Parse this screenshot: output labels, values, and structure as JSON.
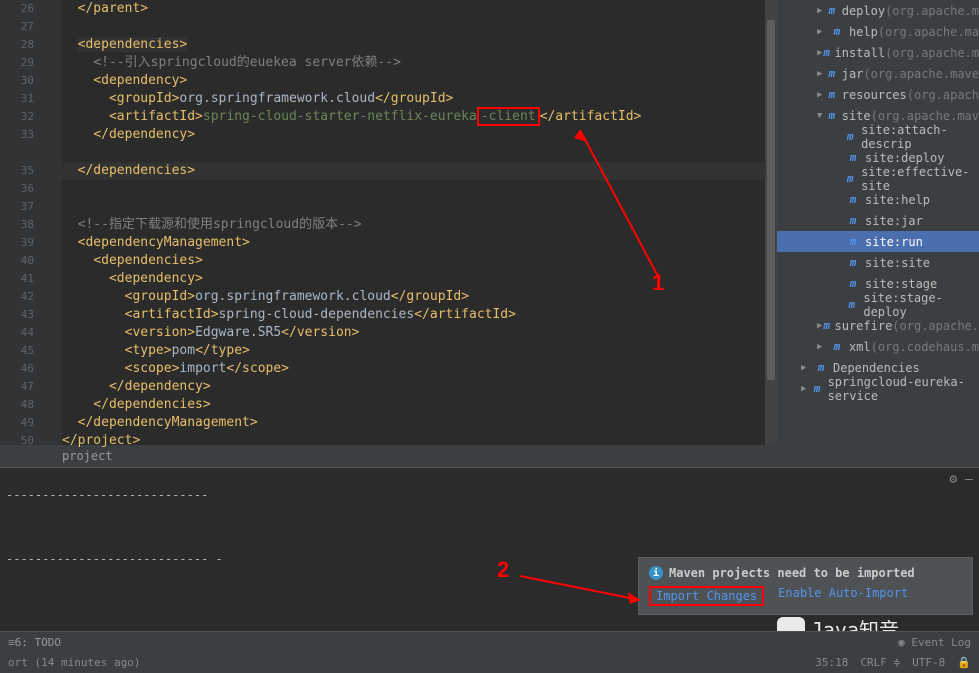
{
  "lineStart": 26,
  "code": {
    "l26": "</parent>",
    "l28a": "<dependencies>",
    "l29a": "<!--引入",
    "l29b": "springcloud",
    "l29c": "的",
    "l29d": "euekea",
    "l29e": " server依赖-->",
    "l30": "<dependency>",
    "l31a": "<groupId>",
    "l31b": "org.springframework.cloud",
    "l31c": "</groupId>",
    "l32a": "<artifactId>",
    "l32b": "spring-cloud-starter-netflix-eureka",
    "l32c": "-client",
    "l32d": "</artifactId>",
    "l33": "</dependency>",
    "l35": "</dependencies>",
    "l38a": "<!--指定下载源和使用",
    "l38b": "springcloud",
    "l38c": "的版本-->",
    "l39": "<dependencyManagement>",
    "l40": "<dependencies>",
    "l41": "<dependency>",
    "l42a": "<groupId>",
    "l42b": "org.springframework.cloud",
    "l42c": "</groupId>",
    "l43a": "<artifactId>",
    "l43b": "spring-cloud-dependencies",
    "l43c": "</artifactId>",
    "l44a": "<version>",
    "l44b": "Edgware.SR5",
    "l44c": "</version>",
    "l45a": "<type>",
    "l45b": "pom",
    "l45c": "</type>",
    "l46a": "<scope>",
    "l46b": "import",
    "l46c": "</scope>",
    "l47": "</dependency>",
    "l48": "</dependencies>",
    "l49": "</dependencyManagement>",
    "l50": "</project>"
  },
  "breadcrumb": "project",
  "tree": [
    {
      "indent": 0,
      "arrow": "▶",
      "icon": "m",
      "label": "deploy",
      "gray": "(org.apache.m"
    },
    {
      "indent": 0,
      "arrow": "▶",
      "icon": "m",
      "label": "help",
      "gray": "(org.apache.ma"
    },
    {
      "indent": 0,
      "arrow": "▶",
      "icon": "m",
      "label": "install",
      "gray": "(org.apache.m"
    },
    {
      "indent": 0,
      "arrow": "▶",
      "icon": "m",
      "label": "jar",
      "gray": "(org.apache.mave"
    },
    {
      "indent": 0,
      "arrow": "▶",
      "icon": "m",
      "label": "resources",
      "gray": "(org.apach"
    },
    {
      "indent": 0,
      "arrow": "▼",
      "icon": "m",
      "label": "site",
      "gray": "(org.apache.mav"
    },
    {
      "indent": 1,
      "arrow": "",
      "icon": "mc",
      "label": "site:attach-descrip",
      "gray": ""
    },
    {
      "indent": 1,
      "arrow": "",
      "icon": "mc",
      "label": "site:deploy",
      "gray": ""
    },
    {
      "indent": 1,
      "arrow": "",
      "icon": "mc",
      "label": "site:effective-site",
      "gray": ""
    },
    {
      "indent": 1,
      "arrow": "",
      "icon": "mc",
      "label": "site:help",
      "gray": ""
    },
    {
      "indent": 1,
      "arrow": "",
      "icon": "mc",
      "label": "site:jar",
      "gray": ""
    },
    {
      "indent": 1,
      "arrow": "",
      "icon": "mc",
      "label": "site:run",
      "gray": "",
      "sel": true
    },
    {
      "indent": 1,
      "arrow": "",
      "icon": "mc",
      "label": "site:site",
      "gray": ""
    },
    {
      "indent": 1,
      "arrow": "",
      "icon": "mc",
      "label": "site:stage",
      "gray": ""
    },
    {
      "indent": 1,
      "arrow": "",
      "icon": "mc",
      "label": "site:stage-deploy",
      "gray": ""
    },
    {
      "indent": 0,
      "arrow": "▶",
      "icon": "m",
      "label": "surefire",
      "gray": "(org.apache."
    },
    {
      "indent": 0,
      "arrow": "▶",
      "icon": "m",
      "label": "xml",
      "gray": "(org.codehaus.m"
    },
    {
      "indent": -1,
      "arrow": "▶",
      "icon": "lib",
      "label": "Dependencies",
      "gray": ""
    },
    {
      "indent": -1,
      "arrow": "▶",
      "icon": "m",
      "label": "springcloud-eureka-service",
      "gray": ""
    }
  ],
  "terminal": {
    "dashes1": "----------------------------",
    "dashes2": "---------------------------- -"
  },
  "notification": {
    "title": "Maven projects need to be imported",
    "action1": "Import Changes",
    "action2": "Enable Auto-Import"
  },
  "annotations": {
    "a1": "1",
    "a2": "2"
  },
  "status": {
    "todo": "6: TODO",
    "line2left": "ort (14 minutes ago)",
    "eventlog": "Event Log",
    "pos": "35:18",
    "crlf": "CRLF",
    "enc": "UTF-8"
  },
  "watermark": "Java知音",
  "url": "https://blog.csdn.net/qq_29519041"
}
